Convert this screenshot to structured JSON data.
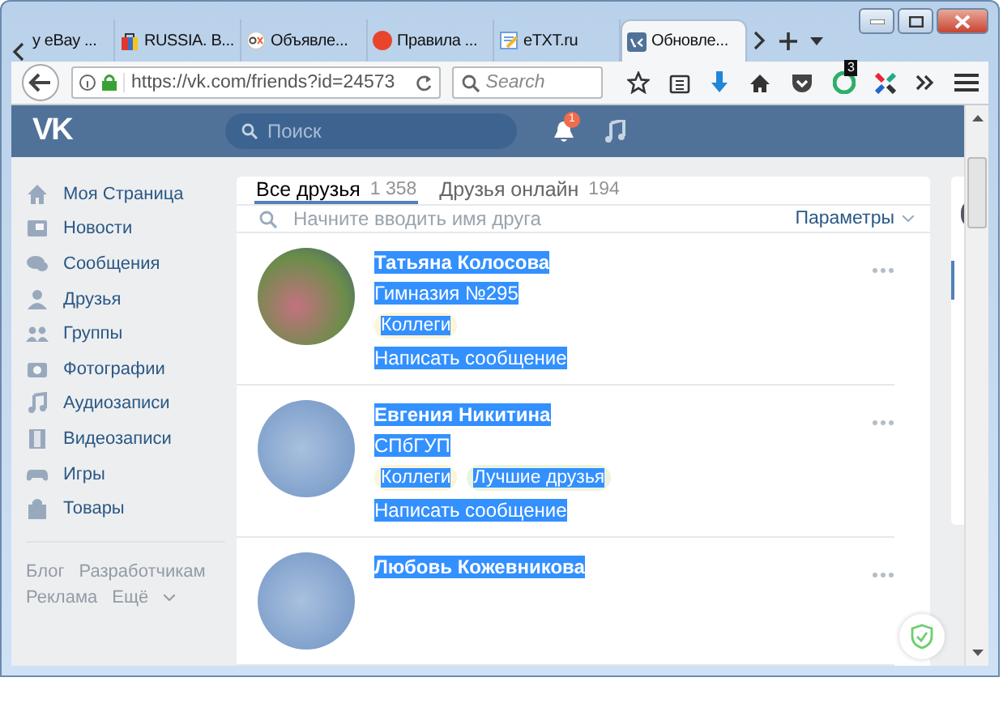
{
  "browser": {
    "tabs": [
      {
        "title": "y eBay ...",
        "kind": "plain",
        "selected": false
      },
      {
        "title": "RUSSIA. B...",
        "kind": "bag",
        "selected": false
      },
      {
        "title": "Объявле...",
        "kind": "olx",
        "selected": false
      },
      {
        "title": "Правила ...",
        "kind": "diy",
        "selected": false
      },
      {
        "title": "eTXT.ru",
        "kind": "note",
        "selected": false
      },
      {
        "title": "Обновле...",
        "kind": "vk",
        "selected": true
      }
    ],
    "url": "https://vk.com/friends?id=24573",
    "search": {
      "placeholder": "Search"
    },
    "extension_badge": "3"
  },
  "vk_header": {
    "logo": "VK",
    "search": {
      "placeholder": "Поиск"
    },
    "notifications_badge": "1"
  },
  "sidebar": {
    "items": [
      {
        "label": "Моя Страница",
        "kind": "home"
      },
      {
        "label": "Новости",
        "kind": "news"
      },
      {
        "label": "Сообщения",
        "kind": "messages"
      },
      {
        "label": "Друзья",
        "kind": "friend"
      },
      {
        "label": "Группы",
        "kind": "groups"
      },
      {
        "label": "Фотографии",
        "kind": "photos"
      },
      {
        "label": "Аудиозаписи",
        "kind": "audio"
      },
      {
        "label": "Видеозаписи",
        "kind": "video"
      },
      {
        "label": "Игры",
        "kind": "games"
      },
      {
        "label": "Товары",
        "kind": "goods"
      }
    ],
    "footer_links": [
      "Блог",
      "Разработчикам",
      "Реклама",
      "Ещё"
    ]
  },
  "friends": {
    "tabs": [
      {
        "label": "Все друзья",
        "count": "1 358",
        "selected": true
      },
      {
        "label": "Друзья онлайн",
        "count": "194",
        "selected": false
      }
    ],
    "search": {
      "placeholder": "Начните вводить имя друга"
    },
    "parameters": "Параметры",
    "list": [
      {
        "name": "Татьяна Колосова",
        "subtitle": "Гимназия №295",
        "tags": [
          {
            "label": "Коллеги",
            "color": "#fbf5d9"
          }
        ],
        "action": "Написать сообщение",
        "highlighted": true
      },
      {
        "name": "Евгения Никитина",
        "subtitle": "СПбГУП",
        "tags": [
          {
            "label": "Коллеги",
            "color": "#fbf5d9"
          },
          {
            "label": "Лучшие друзья",
            "color": "#eaf5e0"
          }
        ],
        "action": "Написать сообщение",
        "highlighted": true
      },
      {
        "name": "Любовь Кожевникова",
        "highlighted": true
      }
    ]
  }
}
